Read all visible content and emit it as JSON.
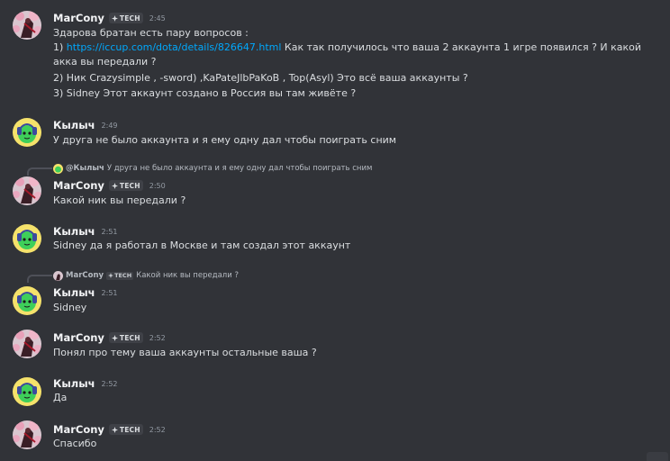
{
  "messages": [
    {
      "author": "MarCony",
      "tag": "TECH",
      "time": "2:45",
      "lines": [
        {
          "text": "Здарова братан есть пару вопросов  :"
        },
        {
          "prefix": "1) ",
          "link": "https://iccup.com/dota/details/826647.html",
          "text": "  Как так получилось что ваша 2 аккаунта 1 игре появился  ? И какой"
        },
        {
          "text": "акка вы передали  ?"
        },
        {
          "text": "2) Ник Crazysimple , -sword) ,KaPateJlbPaKoB  , Top(Asyl)  Это всё  ваша аккаунты  ?"
        },
        {
          "text": "3) Sidney  Этот аккаунт создано в Россия вы там живёте  ?"
        }
      ]
    },
    {
      "author": "Кылыч",
      "time": "2:49",
      "lines": [
        {
          "text": "У друга не было аккаунта и я ему одну дал чтобы поиграть сним"
        }
      ]
    },
    {
      "reply": {
        "name": "@Кылыч",
        "text": "У друга не было аккаунта и я ему одну дал чтобы поиграть сним"
      },
      "author": "MarCony",
      "tag": "TECH",
      "time": "2:50",
      "lines": [
        {
          "text": "Какой ник вы передали ?"
        }
      ]
    },
    {
      "author": "Кылыч",
      "time": "2:51",
      "lines": [
        {
          "text": "Sidney да я работал в Москве и там создал этот аккаунт"
        }
      ]
    },
    {
      "reply": {
        "name": "MarCony",
        "tag": "TECH",
        "text": "Какой ник вы передали ?"
      },
      "author": "Кылыч",
      "time": "2:51",
      "lines": [
        {
          "text": "Sidney"
        }
      ]
    },
    {
      "author": "MarCony",
      "tag": "TECH",
      "time": "2:52",
      "lines": [
        {
          "text": "Понял  про тему ваша аккаунты остальные ваша ?"
        }
      ]
    },
    {
      "author": "Кылыч",
      "time": "2:52",
      "lines": [
        {
          "text": "Да"
        }
      ]
    },
    {
      "author": "MarCony",
      "tag": "TECH",
      "time": "2:52",
      "lines": [
        {
          "text": "Спасибо"
        }
      ]
    }
  ],
  "colors": {
    "background": "#313338",
    "link": "#00a8fc",
    "username": "#f2f3f5",
    "timestamp": "#949ba4"
  }
}
